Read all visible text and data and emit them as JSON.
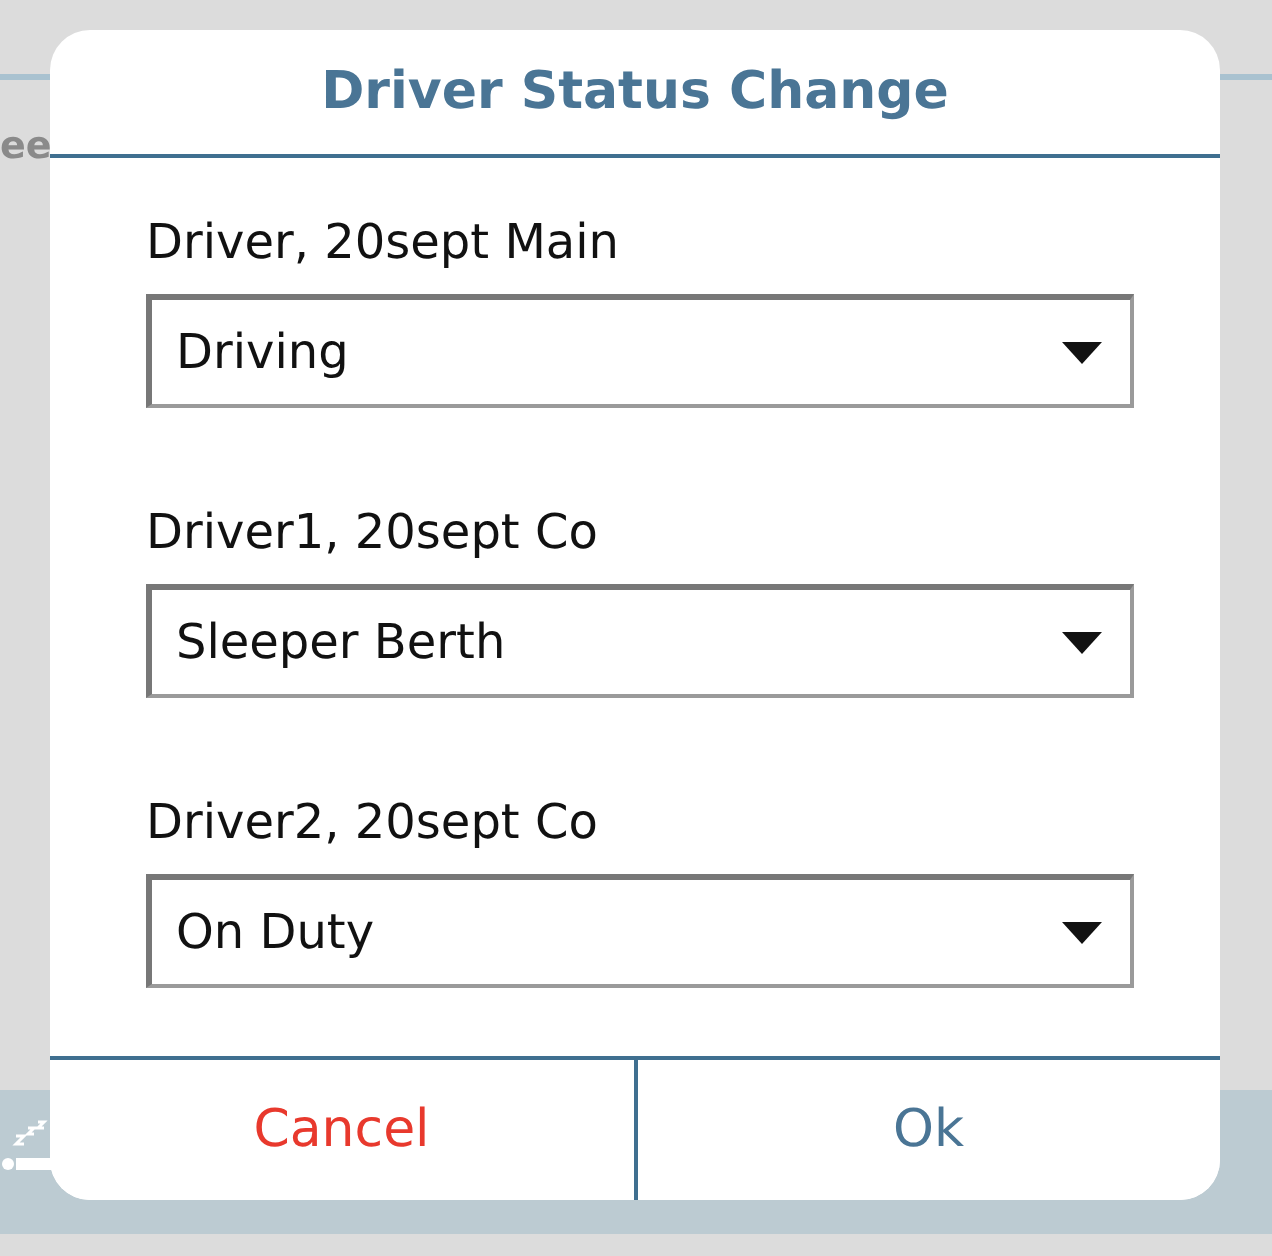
{
  "background": {
    "label": "ee"
  },
  "dialog": {
    "title": "Driver Status Change",
    "fields": [
      {
        "label": "Driver, 20sept Main",
        "value": "Driving"
      },
      {
        "label": "Driver1, 20sept Co",
        "value": "Sleeper Berth"
      },
      {
        "label": "Driver2, 20sept Co",
        "value": "On Duty"
      }
    ],
    "buttons": [
      {
        "kind": "cancel",
        "label": "Cancel"
      },
      {
        "kind": "ok",
        "label": "Ok"
      }
    ]
  }
}
